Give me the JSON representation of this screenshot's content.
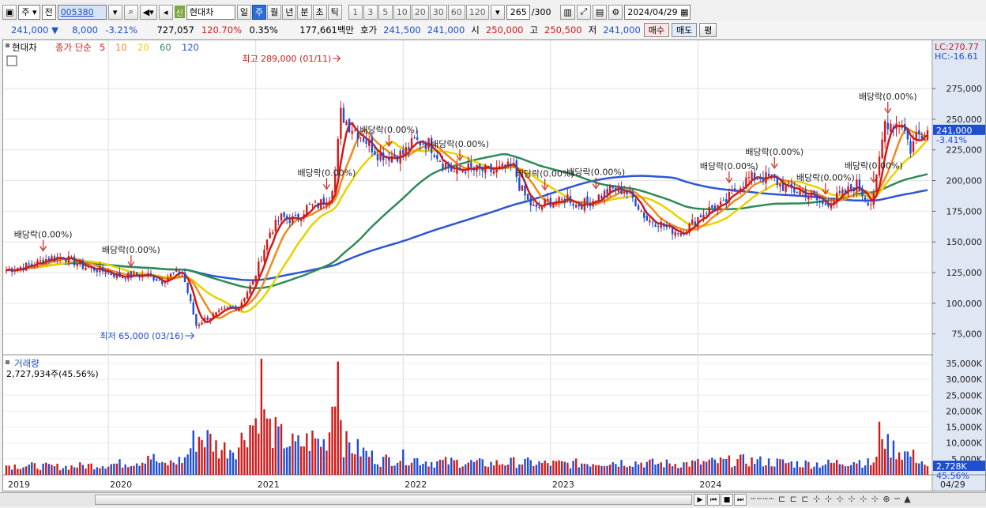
{
  "toolbar": {
    "period_mode": "주",
    "period_mode2": "전",
    "stock_code": "005380",
    "credit_tag": "신",
    "stock_name": "현대차",
    "intervals": [
      "일",
      "주",
      "월",
      "년",
      "분",
      "초",
      "틱"
    ],
    "active_interval": "주",
    "minutes": [
      "1",
      "3",
      "5",
      "10",
      "20",
      "30",
      "60",
      "120"
    ],
    "count": "265",
    "count_max": "/300",
    "date": "2024/04/29"
  },
  "quote": {
    "price": "241,000",
    "change": "8,000",
    "change_rate": "-3.21%",
    "volume": "727,057",
    "volume_ratio": "120.70%",
    "turnover": "0.35%",
    "amount": "177,661백만",
    "ask_label": "호가",
    "ask": "241,500",
    "bid": "241,000",
    "open_label": "시",
    "open": "250,000",
    "high_label": "고",
    "high": "250,500",
    "low_label": "저",
    "low": "241,000",
    "buy_button": "매수",
    "sell_button": "매도",
    "eval_button": "평"
  },
  "price_legend": {
    "name": "현대차",
    "label": "종가 단순",
    "ma": [
      {
        "period": "5",
        "color": "#d21a1a"
      },
      {
        "period": "10",
        "color": "#f08a1c"
      },
      {
        "period": "20",
        "color": "#e8d200"
      },
      {
        "period": "60",
        "color": "#2e8b57"
      },
      {
        "period": "120",
        "color": "#2e55d8"
      }
    ]
  },
  "volume_legend": {
    "name": "거래량",
    "value": "2,727,934주(45.56%)"
  },
  "chart_data": {
    "type": "candlestick",
    "title": "현대차",
    "x_axis_labels": [
      "2019",
      "2020",
      "2021",
      "2022",
      "2023",
      "2024",
      "04/29"
    ],
    "y_ticks": [
      "275,000",
      "250,000",
      "225,000",
      "200,000",
      "175,000",
      "150,000",
      "125,000",
      "100,000",
      "75,000"
    ],
    "ylim": [
      60000,
      295000
    ],
    "volume_ticks": [
      "35,000K",
      "30,000K",
      "25,000K",
      "20,000K",
      "15,000K",
      "10,000K",
      "5,000K"
    ],
    "volume_ylim": [
      0,
      36000
    ],
    "lc": "LC:270.77",
    "hc": "HC:-16.61",
    "last_price": "241,000",
    "last_change": "-3.41%",
    "last_volume": "2,728K",
    "last_volume_pct": "45.56%",
    "high_annotation": "최고 289,000 (01/11)",
    "low_annotation": "최저 65,000 (03/16)",
    "close_anchors": [
      [
        0,
        127000
      ],
      [
        10,
        132000
      ],
      [
        15,
        137000
      ],
      [
        20,
        138000
      ],
      [
        27,
        130000
      ],
      [
        33,
        127000
      ],
      [
        40,
        122000
      ],
      [
        50,
        123000
      ],
      [
        55,
        118000
      ],
      [
        58,
        123000
      ],
      [
        62,
        126000
      ],
      [
        65,
        100000
      ],
      [
        67,
        82000
      ],
      [
        70,
        87000
      ],
      [
        75,
        92000
      ],
      [
        78,
        96000
      ],
      [
        82,
        97000
      ],
      [
        84,
        106000
      ],
      [
        87,
        117000
      ],
      [
        90,
        138000
      ],
      [
        93,
        158000
      ],
      [
        97,
        170000
      ],
      [
        102,
        168000
      ],
      [
        106,
        178000
      ],
      [
        110,
        180000
      ],
      [
        114,
        187000
      ],
      [
        116,
        205000
      ],
      [
        118,
        255000
      ],
      [
        121,
        245000
      ],
      [
        126,
        235000
      ],
      [
        131,
        222000
      ],
      [
        136,
        220000
      ],
      [
        140,
        222000
      ],
      [
        144,
        232000
      ],
      [
        149,
        230000
      ],
      [
        154,
        215000
      ],
      [
        158,
        207000
      ],
      [
        162,
        210000
      ],
      [
        167,
        208000
      ],
      [
        172,
        208000
      ],
      [
        176,
        210000
      ],
      [
        179,
        211000
      ],
      [
        181,
        196000
      ],
      [
        184,
        183000
      ],
      [
        187,
        176000
      ],
      [
        191,
        183000
      ],
      [
        195,
        182000
      ],
      [
        198,
        187000
      ],
      [
        201,
        180000
      ],
      [
        205,
        182000
      ],
      [
        209,
        187000
      ],
      [
        214,
        193000
      ],
      [
        218,
        192000
      ],
      [
        222,
        183000
      ],
      [
        226,
        168000
      ],
      [
        230,
        166000
      ],
      [
        234,
        160000
      ],
      [
        238,
        158000
      ],
      [
        241,
        163000
      ],
      [
        245,
        172000
      ],
      [
        249,
        178000
      ],
      [
        253,
        180000
      ],
      [
        257,
        193000
      ],
      [
        262,
        202000
      ],
      [
        266,
        203000
      ],
      [
        270,
        202000
      ],
      [
        274,
        195000
      ],
      [
        278,
        192000
      ],
      [
        282,
        190000
      ],
      [
        285,
        186000
      ],
      [
        288,
        180000
      ],
      [
        292,
        185000
      ],
      [
        296,
        190000
      ],
      [
        300,
        197000
      ],
      [
        303,
        186000
      ],
      [
        305,
        182000
      ],
      [
        307,
        200000
      ],
      [
        310,
        248000
      ],
      [
        313,
        246000
      ],
      [
        316,
        248000
      ],
      [
        319,
        225000
      ],
      [
        321,
        237000
      ],
      [
        323,
        239000
      ],
      [
        325,
        241000
      ]
    ],
    "volume_anchors": [
      [
        0,
        3000
      ],
      [
        20,
        2500
      ],
      [
        40,
        3500
      ],
      [
        48,
        4500
      ],
      [
        50,
        6500
      ],
      [
        55,
        3000
      ],
      [
        63,
        5000
      ],
      [
        66,
        10500
      ],
      [
        68,
        12000
      ],
      [
        72,
        11000
      ],
      [
        75,
        8000
      ],
      [
        82,
        9000
      ],
      [
        85,
        15000
      ],
      [
        88,
        17000
      ],
      [
        90,
        29000
      ],
      [
        92,
        15000
      ],
      [
        96,
        12000
      ],
      [
        102,
        9000
      ],
      [
        108,
        11000
      ],
      [
        112,
        10000
      ],
      [
        114,
        14000
      ],
      [
        116,
        34000
      ],
      [
        117,
        35000
      ],
      [
        119,
        10000
      ],
      [
        124,
        8000
      ],
      [
        132,
        4500
      ],
      [
        140,
        5500
      ],
      [
        150,
        4000
      ],
      [
        160,
        4000
      ],
      [
        170,
        3500
      ],
      [
        180,
        4000
      ],
      [
        190,
        3500
      ],
      [
        200,
        3500
      ],
      [
        210,
        4000
      ],
      [
        220,
        4000
      ],
      [
        230,
        3500
      ],
      [
        240,
        3500
      ],
      [
        250,
        4000
      ],
      [
        260,
        4500
      ],
      [
        270,
        4000
      ],
      [
        280,
        3500
      ],
      [
        290,
        3500
      ],
      [
        300,
        4500
      ],
      [
        305,
        3500
      ],
      [
        307,
        5000
      ],
      [
        308,
        12500
      ],
      [
        309,
        15000
      ],
      [
        311,
        9000
      ],
      [
        314,
        8000
      ],
      [
        318,
        6500
      ],
      [
        322,
        5000
      ],
      [
        325,
        2700
      ]
    ],
    "dividend_label": "배당락(0.00%)",
    "dividend_weeks": [
      13,
      44,
      113,
      135,
      160,
      190,
      208,
      255,
      271,
      289,
      306,
      311
    ]
  }
}
